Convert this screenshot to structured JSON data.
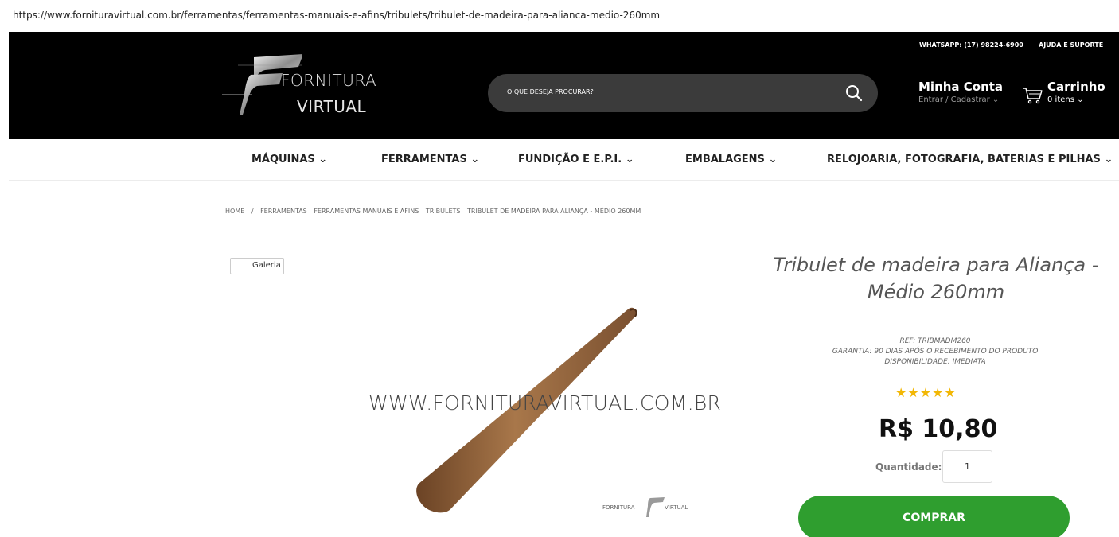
{
  "browser": {
    "url": "https://www.fornituravirtual.com.br/ferramentas/ferramentas-manuais-e-afins/tribulets/tribulet-de-madeira-para-alianca-medio-260mm"
  },
  "header": {
    "logo_top": "FORNITURA",
    "logo_bottom": "VIRTUAL",
    "search_placeholder": "O QUE DESEJA PROCURAR?",
    "whatsapp": "WHATSAPP: (17) 98224-6900",
    "support": "AJUDA E SUPORTE",
    "account_title": "Minha Conta",
    "account_sub": "Entrar / Cadastrar ⌄",
    "cart_title": "Carrinho",
    "cart_sub": "0 itens ⌄"
  },
  "nav": {
    "items": [
      {
        "label": "MÁQUINAS ⌄"
      },
      {
        "label": "FERRAMENTAS ⌄"
      },
      {
        "label": "FUNDIÇÃO E E.P.I. ⌄"
      },
      {
        "label": "EMBALAGENS ⌄"
      },
      {
        "label": "RELOJOARIA, FOTOGRAFIA, BATERIAS E PILHAS ⌄"
      }
    ]
  },
  "breadcrumb": [
    "HOME",
    "/",
    "FERRAMENTAS",
    "FERRAMENTAS MANUAIS E AFINS",
    "TRIBULETS",
    "TRIBULET DE MADEIRA PARA ALIANÇA - MÉDIO 260MM"
  ],
  "gallery": {
    "button_label": "Galeria"
  },
  "image": {
    "watermark": "WWW.FORNITURAVIRTUAL.COM.BR",
    "mini_logo_left": "FORNITURA",
    "mini_logo_right": "VIRTUAL"
  },
  "product": {
    "title": "Tribulet de madeira para Aliança - Médio 260mm",
    "ref": "REF: TRIBMADM260",
    "warranty": "GARANTIA: 90 DIAS APÓS O RECEBIMENTO DO PRODUTO",
    "availability": "DISPONIBILIDADE: IMEDIATA",
    "stars": "★★★★★",
    "price": "R$ 10,80",
    "quantity_label": "Quantidade:",
    "quantity_value": "1",
    "buy_label": "COMPRAR"
  },
  "colors": {
    "header_bg": "#000000",
    "buy_button": "#2f9e2f",
    "stars": "#f2b705"
  }
}
